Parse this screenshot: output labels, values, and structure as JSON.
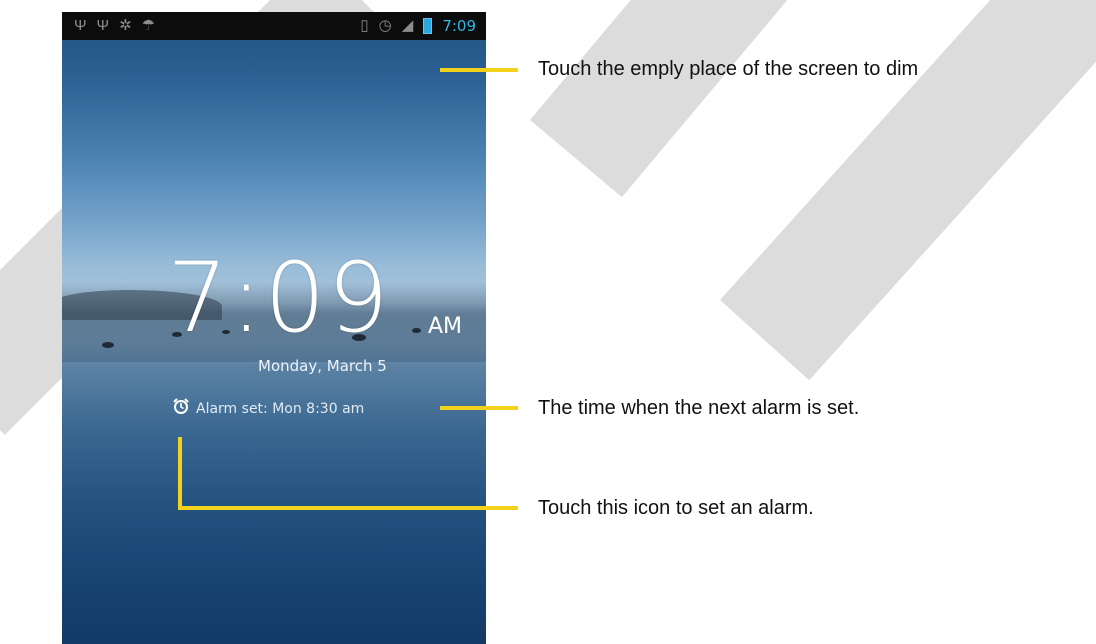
{
  "status_bar": {
    "left_icons": [
      "usb-icon",
      "usb-icon",
      "android-debug-icon",
      "wifi-icon"
    ],
    "right_icons": [
      "sim-icon",
      "alarm-status-icon",
      "signal-icon",
      "battery-icon"
    ],
    "time": "7:09",
    "time_color": "#33b5e5"
  },
  "lockscreen": {
    "clock_time": "7:09",
    "ampm": "AM",
    "date": "Monday, March 5",
    "alarm_text": "Alarm set: Mon 8:30 am",
    "alarm_icon": "alarm-clock-icon"
  },
  "annotations": {
    "dim": "Touch the emply place of the screen to dim",
    "next_alarm": "The time when the next alarm is set.",
    "alarm_icon": "Touch this icon to set an alarm."
  },
  "colors": {
    "callout_yellow": "#f3d21b",
    "watermark": "#dcdcdc"
  }
}
